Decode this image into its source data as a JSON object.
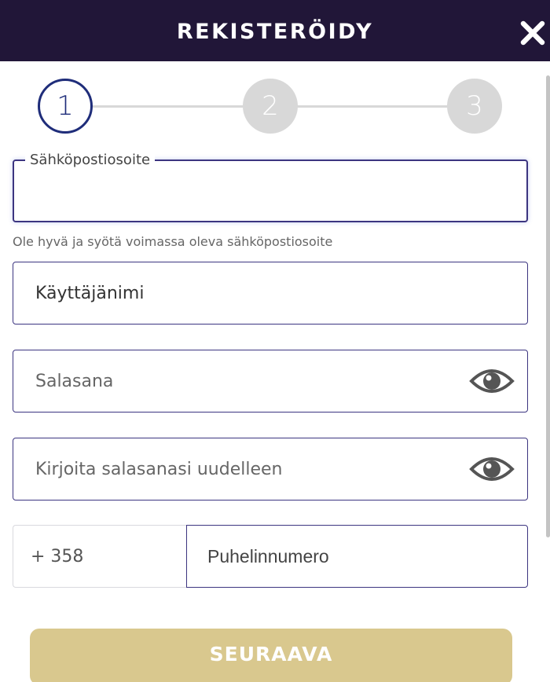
{
  "header": {
    "title": "REKISTERÖIDY",
    "close_icon": "close-icon"
  },
  "stepper": {
    "current_step": 1,
    "steps": [
      "1",
      "2",
      "3"
    ],
    "active_color": "#1f2d7a",
    "inactive_color": "#d8d8d8"
  },
  "form": {
    "email": {
      "label": "Sähköpostiosoite",
      "value": "",
      "helper": "Ole hyvä ja syötä voimassa oleva sähköpostiosoite"
    },
    "username": {
      "value": "Käyttäjänimi"
    },
    "password": {
      "placeholder": "Salasana",
      "toggle_icon": "eye-icon"
    },
    "password_confirm": {
      "placeholder": "Kirjoita salasanasi uudelleen",
      "toggle_icon": "eye-icon"
    },
    "phone": {
      "prefix": "+ 358",
      "placeholder": "Puhelinnumero"
    }
  },
  "actions": {
    "next_label": "SEURAAVA",
    "next_color": "#d9c88e"
  },
  "colors": {
    "header_bg": "#211638",
    "field_border": "#3c3580"
  }
}
